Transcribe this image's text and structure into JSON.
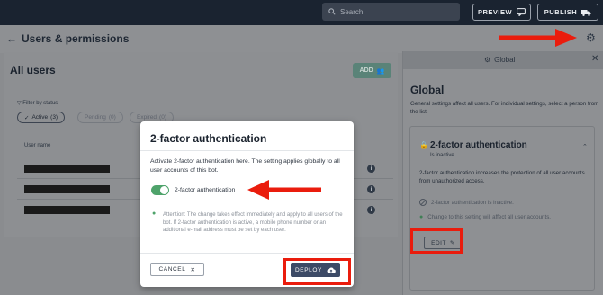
{
  "topbar": {
    "search_placeholder": "Search",
    "preview_label": "PREVIEW",
    "publish_label": "PUBLISH"
  },
  "header": {
    "title": "Users & permissions"
  },
  "users": {
    "title": "All users",
    "add_label": "ADD",
    "filter_label": "Filter by status",
    "filters": [
      {
        "label": "Active",
        "count": "(3)"
      },
      {
        "label": "Pending",
        "count": "(0)"
      },
      {
        "label": "Expired",
        "count": "(0)"
      }
    ],
    "column_user": "User name"
  },
  "global_panel": {
    "tab_label": "Global",
    "title": "Global",
    "description": "General settings affect all users. For individual settings, select a person from the list.",
    "card": {
      "title": "2-factor authentication",
      "status": "Is inactive",
      "description": "2-factor authentication increases the protection of all user accounts from unauthorized access.",
      "inactive_note": "2-factor authentication is inactive.",
      "affect_note": "Change to this setting will affect all user accounts.",
      "edit_label": "EDIT"
    }
  },
  "modal": {
    "title": "2-factor authentication",
    "description": "Activate 2-factor authentication here. The setting applies globally to all user accounts of this bot.",
    "toggle_label": "2-factor authentication",
    "toggle_on": true,
    "attention": "Attention: The change takes effect immediately and apply to all users of the bot. If 2-factor authentication is active, a mobile phone number or an additional e-mail address must be set by each user.",
    "cancel_label": "CANCEL",
    "deploy_label": "DEPLOY"
  },
  "colors": {
    "annotation_red": "#ea1c0d",
    "toggle_green": "#4fa36b",
    "deploy_navy": "#3c4a66",
    "topbar": "#1a2330"
  }
}
